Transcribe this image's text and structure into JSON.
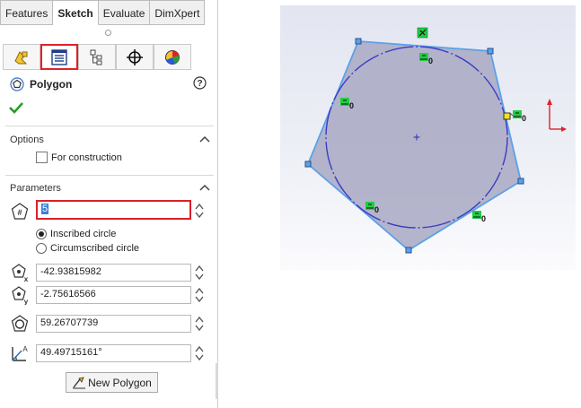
{
  "tabs": [
    "Features",
    "Sketch",
    "Evaluate",
    "DimXpert"
  ],
  "active_tab": "Sketch",
  "feature": {
    "title": "Polygon"
  },
  "options": {
    "header": "Options",
    "for_construction_label": "For construction",
    "for_construction_checked": false
  },
  "parameters": {
    "header": "Parameters",
    "sides_value": "5",
    "inscribed_label": "Inscribed circle",
    "circumscribed_label": "Circumscribed circle",
    "selected_mode": "Inscribed circle",
    "center_x": "-42.93815982",
    "center_y": "-2.75616566",
    "diameter": "59.26707739",
    "angle": "49.49715161°"
  },
  "new_polygon_label": "New Polygon",
  "relation_labels": [
    "0",
    "0",
    "0",
    "0",
    "0"
  ],
  "colors": {
    "polygon_fill": "#a8a8c3",
    "polygon_edge": "#5aa1e8",
    "construction_circle": "#3b3bc4",
    "axis_red": "#e0202a",
    "highlight_red": "#d92028",
    "relation_green": "#22cc44"
  },
  "icons": [
    "sheet-metal-icon",
    "property-manager-icon",
    "configuration-manager-icon",
    "dimxpert-manager-icon",
    "display-manager-icon",
    "polygon-icon",
    "help-icon",
    "ok-checkmark-icon",
    "chevron-up-icon",
    "sides-icon",
    "center-x-icon",
    "center-y-icon",
    "circle-diameter-icon",
    "angle-icon",
    "spinner-icon",
    "coincident-relation-icon",
    "triad-axis-icon"
  ]
}
